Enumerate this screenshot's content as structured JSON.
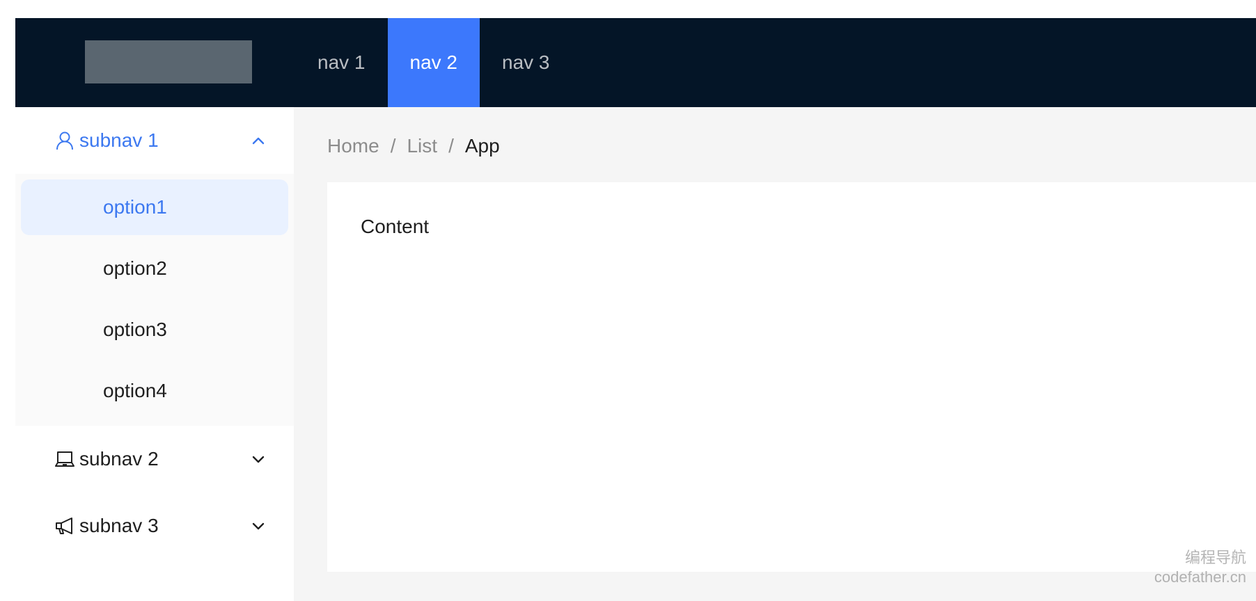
{
  "header": {
    "nav": [
      {
        "label": "nav 1",
        "active": false
      },
      {
        "label": "nav 2",
        "active": true
      },
      {
        "label": "nav 3",
        "active": false
      }
    ],
    "accent_color": "#3c78fc",
    "background_color": "#041527"
  },
  "sidebar": {
    "submenus": [
      {
        "label": "subnav 1",
        "icon": "user-icon",
        "open": true,
        "options": [
          {
            "label": "option1",
            "selected": true
          },
          {
            "label": "option2",
            "selected": false
          },
          {
            "label": "option3",
            "selected": false
          },
          {
            "label": "option4",
            "selected": false
          }
        ]
      },
      {
        "label": "subnav 2",
        "icon": "laptop-icon",
        "open": false
      },
      {
        "label": "subnav 3",
        "icon": "notification-icon",
        "open": false
      }
    ]
  },
  "breadcrumb": {
    "items": [
      "Home",
      "List",
      "App"
    ],
    "separator": "/"
  },
  "main": {
    "content": "Content"
  },
  "watermark": {
    "line1": "编程导航",
    "line2": "codefather.cn"
  }
}
